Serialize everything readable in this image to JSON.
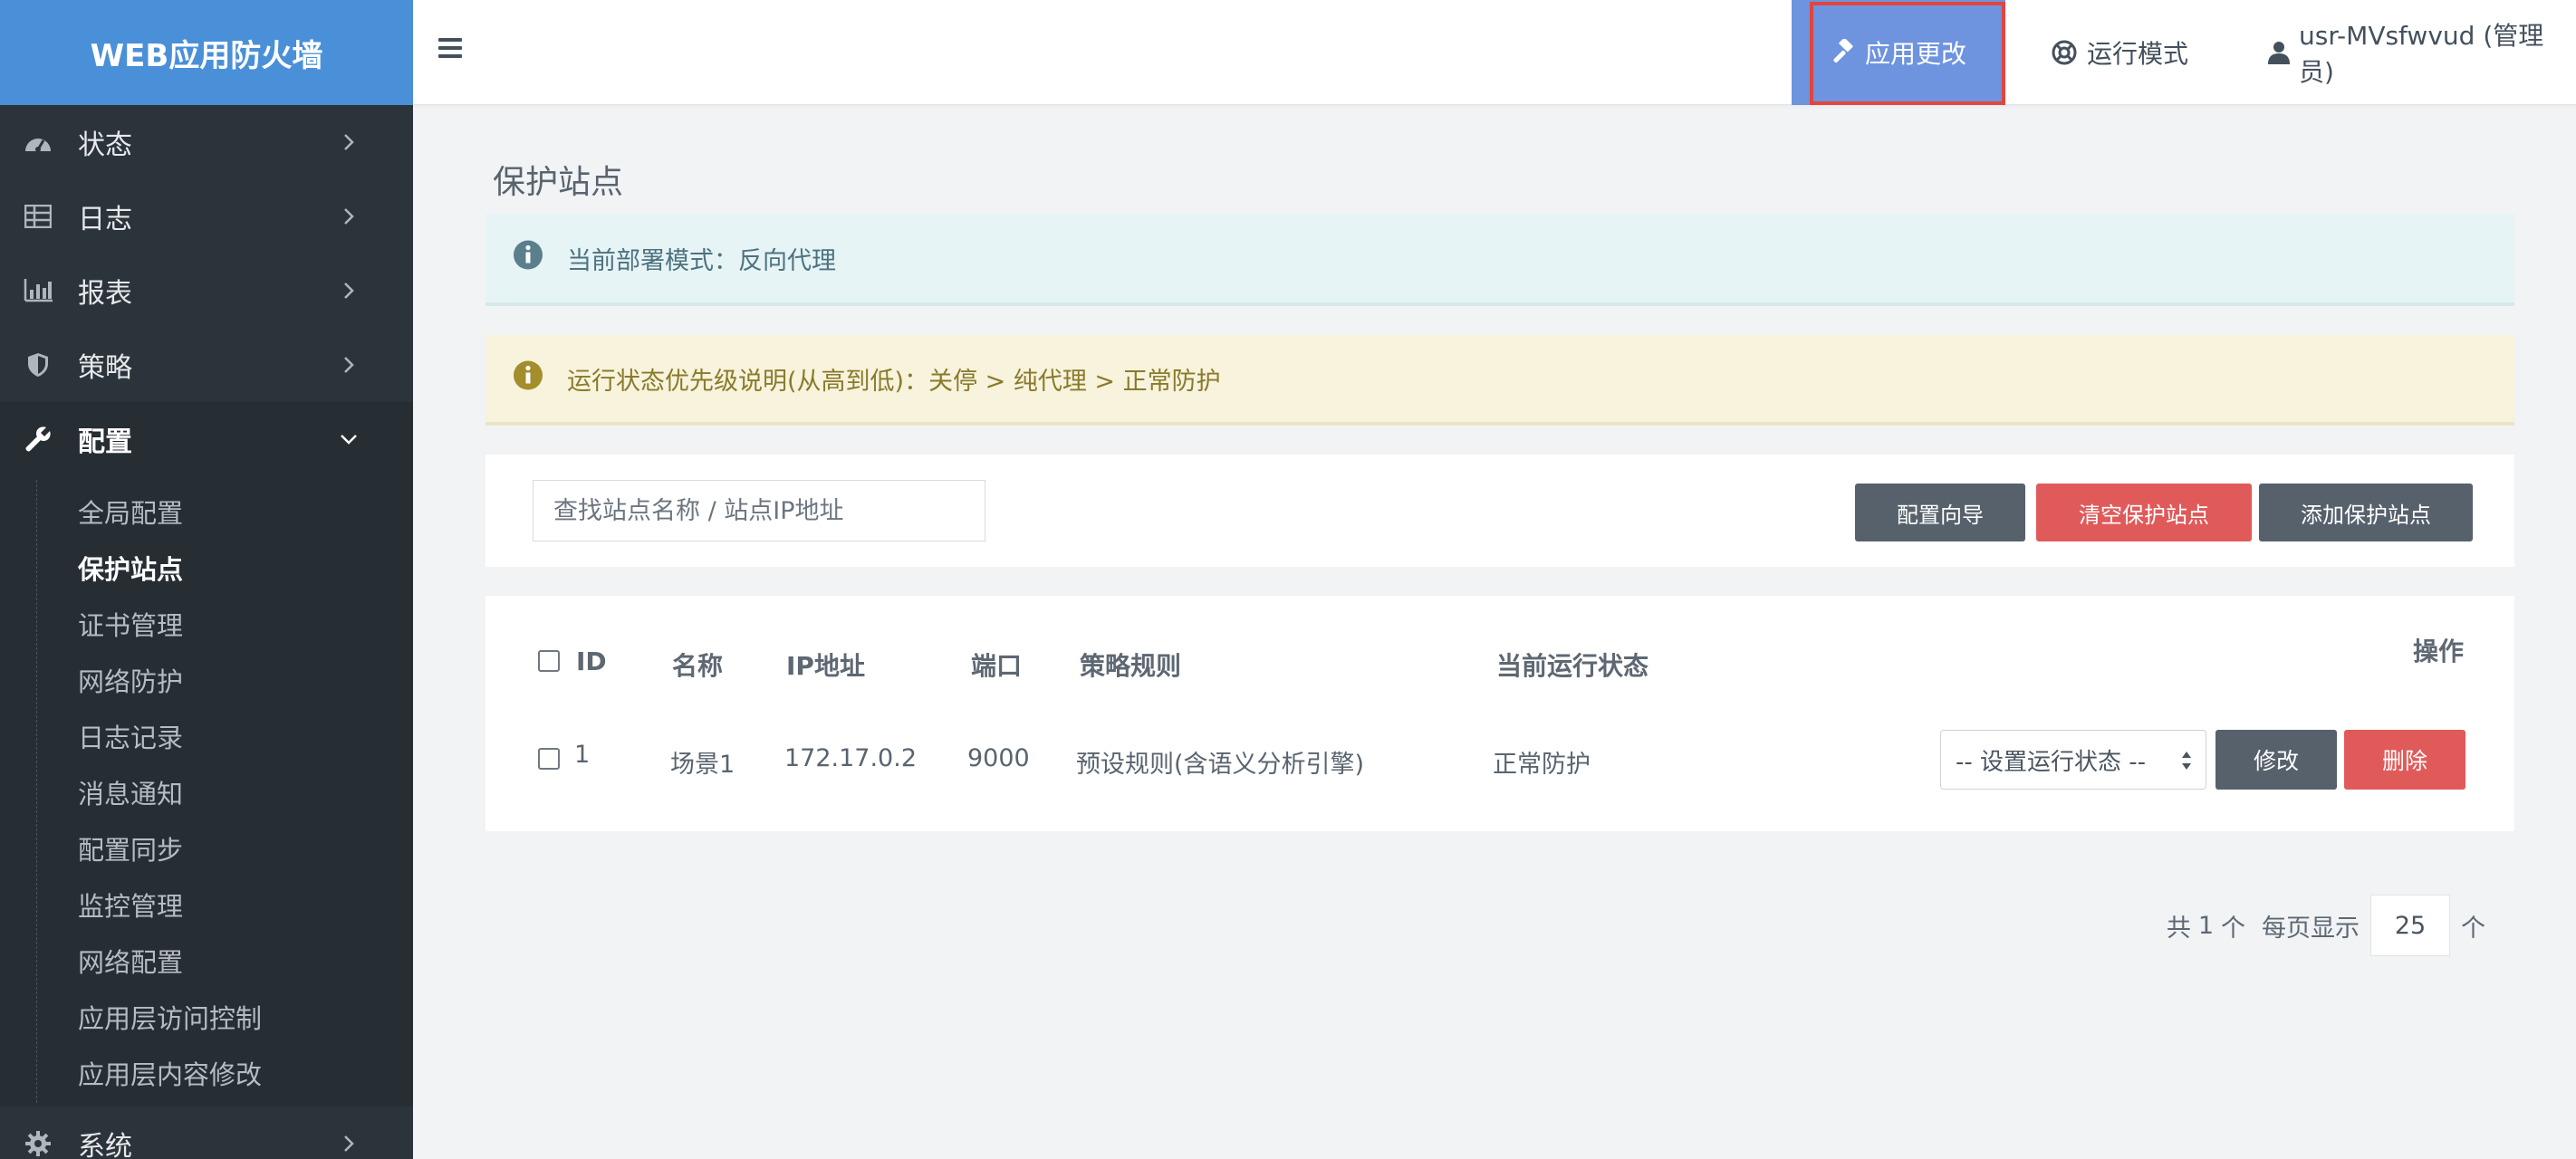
{
  "app": {
    "title": "WEB应用防火墙"
  },
  "sidebar": {
    "items": [
      {
        "label": "状态",
        "icon": "dashboard-icon"
      },
      {
        "label": "日志",
        "icon": "table-icon"
      },
      {
        "label": "报表",
        "icon": "bar-chart-icon"
      },
      {
        "label": "策略",
        "icon": "shield-icon"
      },
      {
        "label": "配置",
        "icon": "wrench-icon"
      },
      {
        "label": "系统",
        "icon": "gear-icon"
      }
    ],
    "config_sub": [
      "全局配置",
      "保护站点",
      "证书管理",
      "网络防护",
      "日志记录",
      "消息通知",
      "配置同步",
      "监控管理",
      "网络配置",
      "应用层访问控制",
      "应用层内容修改"
    ],
    "current_sub": "保护站点"
  },
  "topbar": {
    "apply_label": "应用更改",
    "mode_label": "运行模式",
    "user_label": "usr-MVsfwvud (管理员)"
  },
  "page": {
    "title": "保护站点",
    "info_alert": "当前部署模式：反向代理",
    "warn_alert": "运行状态优先级说明(从高到低)：关停 > 纯代理 > 正常防护"
  },
  "toolbar": {
    "search_placeholder": "查找站点名称 / 站点IP地址",
    "wizard_label": "配置向导",
    "clear_label": "清空保护站点",
    "add_label": "添加保护站点"
  },
  "table": {
    "headers": {
      "id": "ID",
      "name": "名称",
      "ip": "IP地址",
      "port": "端口",
      "policy": "策略规则",
      "status": "当前运行状态",
      "ops": "操作"
    },
    "rows": [
      {
        "id": "1",
        "name": "场景1",
        "ip": "172.17.0.2",
        "port": "9000",
        "policy": "预设规则(含语义分析引擎)",
        "status": "正常防护",
        "select_label": "-- 设置运行状态 --",
        "edit_label": "修改",
        "delete_label": "删除"
      }
    ]
  },
  "pager": {
    "total_prefix": "共",
    "total_count": "1",
    "total_unit": "个",
    "per_page_label": "每页显示",
    "page_size": "25",
    "page_unit": "个"
  },
  "colors": {
    "brand": "#4a90d9",
    "sidebar": "#2c343b",
    "apply": "#6e93df",
    "danger": "#e05a5a",
    "dark_btn": "#56616c"
  }
}
